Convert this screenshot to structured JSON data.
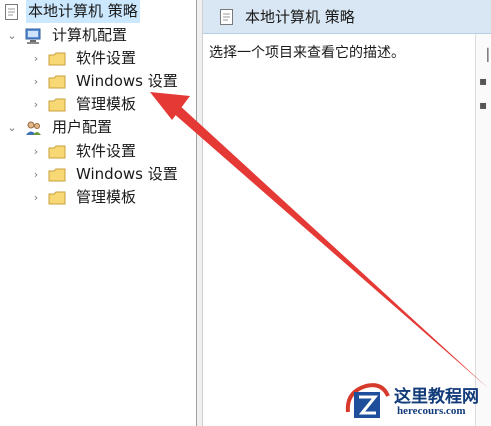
{
  "tree": {
    "root_label": "本地计算机 策略",
    "computer_config": {
      "label": "计算机配置",
      "children": [
        "软件设置",
        "Windows 设置",
        "管理模板"
      ]
    },
    "user_config": {
      "label": "用户配置",
      "children": [
        "软件设置",
        "Windows 设置",
        "管理模板"
      ]
    }
  },
  "right_pane": {
    "header_title": "本地计算机 策略",
    "description": "选择一个项目来查看它的描述。"
  },
  "watermark": {
    "title": "这里教程网",
    "url": "herecours.com"
  },
  "colors": {
    "header_bg": "#d9e6f3",
    "selected_bg": "#cce8ff",
    "folder_fill": "#f8d775",
    "arrow_red": "#e53935",
    "watermark_blue": "#123b7a"
  }
}
